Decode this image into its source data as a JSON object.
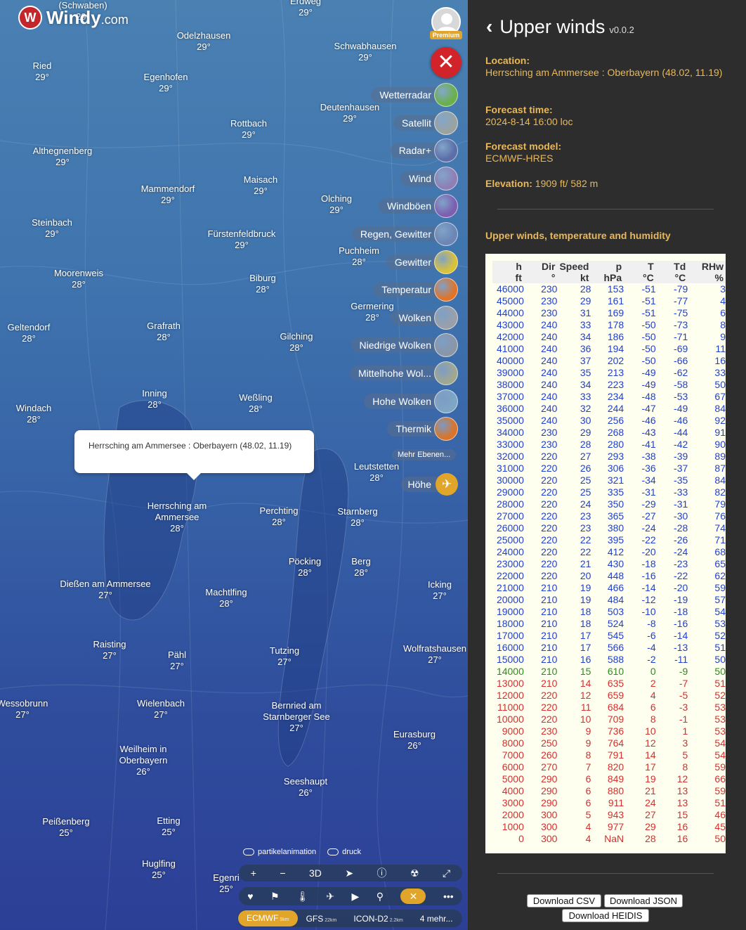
{
  "map": {
    "logo": {
      "brand": "Windy",
      "domain": ".com"
    },
    "premium_label": "Premium",
    "cities": [
      {
        "name": "(Schwaben)",
        "temp": "29°"
      },
      {
        "name": "Erdweg",
        "temp": "29°"
      },
      {
        "name": "Odelzhausen",
        "temp": "29°"
      },
      {
        "name": "Schwabhausen",
        "temp": "29°"
      },
      {
        "name": "Ried",
        "temp": "29°"
      },
      {
        "name": "Egenhofen",
        "temp": "29°"
      },
      {
        "name": "Deutenhausen",
        "temp": "29°"
      },
      {
        "name": "Rottbach",
        "temp": "29°"
      },
      {
        "name": "Althegnenberg",
        "temp": "29°"
      },
      {
        "name": "Mammendorf",
        "temp": "29°"
      },
      {
        "name": "Maisach",
        "temp": "29°"
      },
      {
        "name": "Olching",
        "temp": "29°"
      },
      {
        "name": "Steinbach",
        "temp": "29°"
      },
      {
        "name": "Fürstenfeldbruck",
        "temp": "29°"
      },
      {
        "name": "Puchheim",
        "temp": "28°"
      },
      {
        "name": "Moorenweis",
        "temp": "28°"
      },
      {
        "name": "Biburg",
        "temp": "28°"
      },
      {
        "name": "Germering",
        "temp": "28°"
      },
      {
        "name": "Geltendorf",
        "temp": "28°"
      },
      {
        "name": "Grafrath",
        "temp": "28°"
      },
      {
        "name": "Gilching",
        "temp": "28°"
      },
      {
        "name": "Inning",
        "temp": "28°"
      },
      {
        "name": "Weßling",
        "temp": "28°"
      },
      {
        "name": "Windach",
        "temp": "28°"
      },
      {
        "name": "Leutstetten",
        "temp": "28°"
      },
      {
        "name": "Herrsching am Ammersee",
        "temp": "28°"
      },
      {
        "name": "Perchting",
        "temp": "28°"
      },
      {
        "name": "Starnberg",
        "temp": "28°"
      },
      {
        "name": "Pöcking",
        "temp": "28°"
      },
      {
        "name": "Berg",
        "temp": "28°"
      },
      {
        "name": "Dießen am Ammersee",
        "temp": "27°"
      },
      {
        "name": "Machtlfing",
        "temp": "28°"
      },
      {
        "name": "Icking",
        "temp": "27°"
      },
      {
        "name": "Raisting",
        "temp": "27°"
      },
      {
        "name": "Pähl",
        "temp": "27°"
      },
      {
        "name": "Tutzing",
        "temp": "27°"
      },
      {
        "name": "Wolfratshausen",
        "temp": "27°"
      },
      {
        "name": "Wessobrunn",
        "temp": "27°"
      },
      {
        "name": "Wielenbach",
        "temp": "27°"
      },
      {
        "name": "Bernried am Starnberger See",
        "temp": "27°"
      },
      {
        "name": "Eurasburg",
        "temp": "26°"
      },
      {
        "name": "Weilheim in Oberbayern",
        "temp": "26°"
      },
      {
        "name": "Seeshaupt",
        "temp": "26°"
      },
      {
        "name": "Peißenberg",
        "temp": "25°"
      },
      {
        "name": "Etting",
        "temp": "25°"
      },
      {
        "name": "Huglfing",
        "temp": "25°"
      },
      {
        "name": "Egenri",
        "temp": "25°"
      }
    ],
    "layers": [
      {
        "label": "Wetterradar",
        "color": "#6ab04c"
      },
      {
        "label": "Satellit",
        "color": "#9aa3a0"
      },
      {
        "label": "Radar+",
        "color": "#5b6ea8"
      },
      {
        "label": "Wind",
        "color": "#8e7fb5"
      },
      {
        "label": "Windböen",
        "color": "#7d5fb0"
      },
      {
        "label": "Regen, Gewitter",
        "color": "#6c86b5"
      },
      {
        "label": "Gewitter",
        "color": "#d9c13a"
      },
      {
        "label": "Temperatur",
        "color": "#e0742a"
      },
      {
        "label": "Wolken",
        "color": "#9aa0a8"
      },
      {
        "label": "Niedrige Wolken",
        "color": "#8b96a6"
      },
      {
        "label": "Mittelhohe Wol...",
        "color": "#a0a890"
      },
      {
        "label": "Hohe Wolken",
        "color": "#7fa6c4"
      },
      {
        "label": "Thermik",
        "color": "#d9752a"
      }
    ],
    "more_layers": "Mehr Ebenen...",
    "hoehe_label": "Höhe",
    "popup_text": "Herrsching am Ammersee : Oberbayern (48.02, 11.19)",
    "toggles": [
      "partikelanimation",
      "druck"
    ],
    "controls": [
      "+",
      "−",
      "3D",
      "➤",
      "ⓘ",
      "☢",
      "⤢"
    ],
    "models": [
      {
        "name": "ECMWF",
        "res": "9km"
      },
      {
        "name": "GFS",
        "res": "22km"
      },
      {
        "name": "ICON-D2",
        "res": "2.2km"
      },
      {
        "name": "4 mehr...",
        "res": ""
      }
    ]
  },
  "panel": {
    "title": "Upper winds",
    "version": "v0.0.2",
    "location_label": "Location:",
    "location_value": "Herrsching am Ammersee : Oberbayern (48.02, 11.19)",
    "forecast_time_label": "Forecast time:",
    "forecast_time_value": "2024-8-14 16:00 loc",
    "forecast_model_label": "Forecast model:",
    "forecast_model_value": "ECMWF-HRES",
    "elevation_label": "Elevation:",
    "elevation_value": "1909 ft/ 582 m",
    "subtitle": "Upper winds, temperature and humidity",
    "columns": [
      [
        "h",
        "ft"
      ],
      [
        "Dir",
        "°"
      ],
      [
        "Speed",
        "kt"
      ],
      [
        "p",
        "hPa"
      ],
      [
        "T",
        "°C"
      ],
      [
        "Td",
        "°C"
      ],
      [
        "RHw",
        "%"
      ]
    ],
    "rows": [
      [
        "46000",
        "230",
        "28",
        "153",
        "-51",
        "-79",
        "3",
        "blue"
      ],
      [
        "45000",
        "230",
        "29",
        "161",
        "-51",
        "-77",
        "4",
        "blue"
      ],
      [
        "44000",
        "230",
        "31",
        "169",
        "-51",
        "-75",
        "6",
        "blue"
      ],
      [
        "43000",
        "240",
        "33",
        "178",
        "-50",
        "-73",
        "8",
        "blue"
      ],
      [
        "42000",
        "240",
        "34",
        "186",
        "-50",
        "-71",
        "9",
        "blue"
      ],
      [
        "41000",
        "240",
        "36",
        "194",
        "-50",
        "-69",
        "11",
        "blue"
      ],
      [
        "40000",
        "240",
        "37",
        "202",
        "-50",
        "-66",
        "16",
        "blue"
      ],
      [
        "39000",
        "240",
        "35",
        "213",
        "-49",
        "-62",
        "33",
        "blue"
      ],
      [
        "38000",
        "240",
        "34",
        "223",
        "-49",
        "-58",
        "50",
        "blue"
      ],
      [
        "37000",
        "240",
        "33",
        "234",
        "-48",
        "-53",
        "67",
        "blue"
      ],
      [
        "36000",
        "240",
        "32",
        "244",
        "-47",
        "-49",
        "84",
        "blue"
      ],
      [
        "35000",
        "240",
        "30",
        "256",
        "-46",
        "-46",
        "92",
        "blue"
      ],
      [
        "34000",
        "230",
        "29",
        "268",
        "-43",
        "-44",
        "91",
        "blue"
      ],
      [
        "33000",
        "230",
        "28",
        "280",
        "-41",
        "-42",
        "90",
        "blue"
      ],
      [
        "32000",
        "220",
        "27",
        "293",
        "-38",
        "-39",
        "89",
        "blue"
      ],
      [
        "31000",
        "220",
        "26",
        "306",
        "-36",
        "-37",
        "87",
        "blue"
      ],
      [
        "30000",
        "220",
        "25",
        "321",
        "-34",
        "-35",
        "84",
        "blue"
      ],
      [
        "29000",
        "220",
        "25",
        "335",
        "-31",
        "-33",
        "82",
        "blue"
      ],
      [
        "28000",
        "220",
        "24",
        "350",
        "-29",
        "-31",
        "79",
        "blue"
      ],
      [
        "27000",
        "220",
        "23",
        "365",
        "-27",
        "-30",
        "76",
        "blue"
      ],
      [
        "26000",
        "220",
        "23",
        "380",
        "-24",
        "-28",
        "74",
        "blue"
      ],
      [
        "25000",
        "220",
        "22",
        "395",
        "-22",
        "-26",
        "71",
        "blue"
      ],
      [
        "24000",
        "220",
        "22",
        "412",
        "-20",
        "-24",
        "68",
        "blue"
      ],
      [
        "23000",
        "220",
        "21",
        "430",
        "-18",
        "-23",
        "65",
        "blue"
      ],
      [
        "22000",
        "220",
        "20",
        "448",
        "-16",
        "-22",
        "62",
        "blue"
      ],
      [
        "21000",
        "210",
        "19",
        "466",
        "-14",
        "-20",
        "59",
        "blue"
      ],
      [
        "20000",
        "210",
        "19",
        "484",
        "-12",
        "-19",
        "57",
        "blue"
      ],
      [
        "19000",
        "210",
        "18",
        "503",
        "-10",
        "-18",
        "54",
        "blue"
      ],
      [
        "18000",
        "210",
        "18",
        "524",
        "-8",
        "-16",
        "53",
        "blue"
      ],
      [
        "17000",
        "210",
        "17",
        "545",
        "-6",
        "-14",
        "52",
        "blue"
      ],
      [
        "16000",
        "210",
        "17",
        "566",
        "-4",
        "-13",
        "51",
        "blue"
      ],
      [
        "15000",
        "210",
        "16",
        "588",
        "-2",
        "-11",
        "50",
        "blue"
      ],
      [
        "14000",
        "210",
        "15",
        "610",
        "0",
        "-9",
        "50",
        "green"
      ],
      [
        "13000",
        "210",
        "14",
        "635",
        "2",
        "-7",
        "51",
        "red"
      ],
      [
        "12000",
        "220",
        "12",
        "659",
        "4",
        "-5",
        "52",
        "red"
      ],
      [
        "11000",
        "220",
        "11",
        "684",
        "6",
        "-3",
        "53",
        "red"
      ],
      [
        "10000",
        "220",
        "10",
        "709",
        "8",
        "-1",
        "53",
        "red"
      ],
      [
        "9000",
        "230",
        "9",
        "736",
        "10",
        "1",
        "53",
        "red"
      ],
      [
        "8000",
        "250",
        "9",
        "764",
        "12",
        "3",
        "54",
        "red"
      ],
      [
        "7000",
        "260",
        "8",
        "791",
        "14",
        "5",
        "54",
        "red"
      ],
      [
        "6000",
        "270",
        "7",
        "820",
        "17",
        "8",
        "59",
        "red"
      ],
      [
        "5000",
        "290",
        "6",
        "849",
        "19",
        "12",
        "66",
        "red"
      ],
      [
        "4000",
        "290",
        "6",
        "880",
        "21",
        "13",
        "59",
        "red"
      ],
      [
        "3000",
        "290",
        "6",
        "911",
        "24",
        "13",
        "51",
        "red"
      ],
      [
        "2000",
        "300",
        "5",
        "943",
        "27",
        "15",
        "46",
        "red"
      ],
      [
        "1000",
        "300",
        "4",
        "977",
        "29",
        "16",
        "45",
        "red"
      ],
      [
        "0",
        "300",
        "4",
        "NaN",
        "28",
        "16",
        "50",
        "red"
      ]
    ],
    "buttons": [
      "Download CSV",
      "Download JSON",
      "Download HEIDIS"
    ]
  }
}
